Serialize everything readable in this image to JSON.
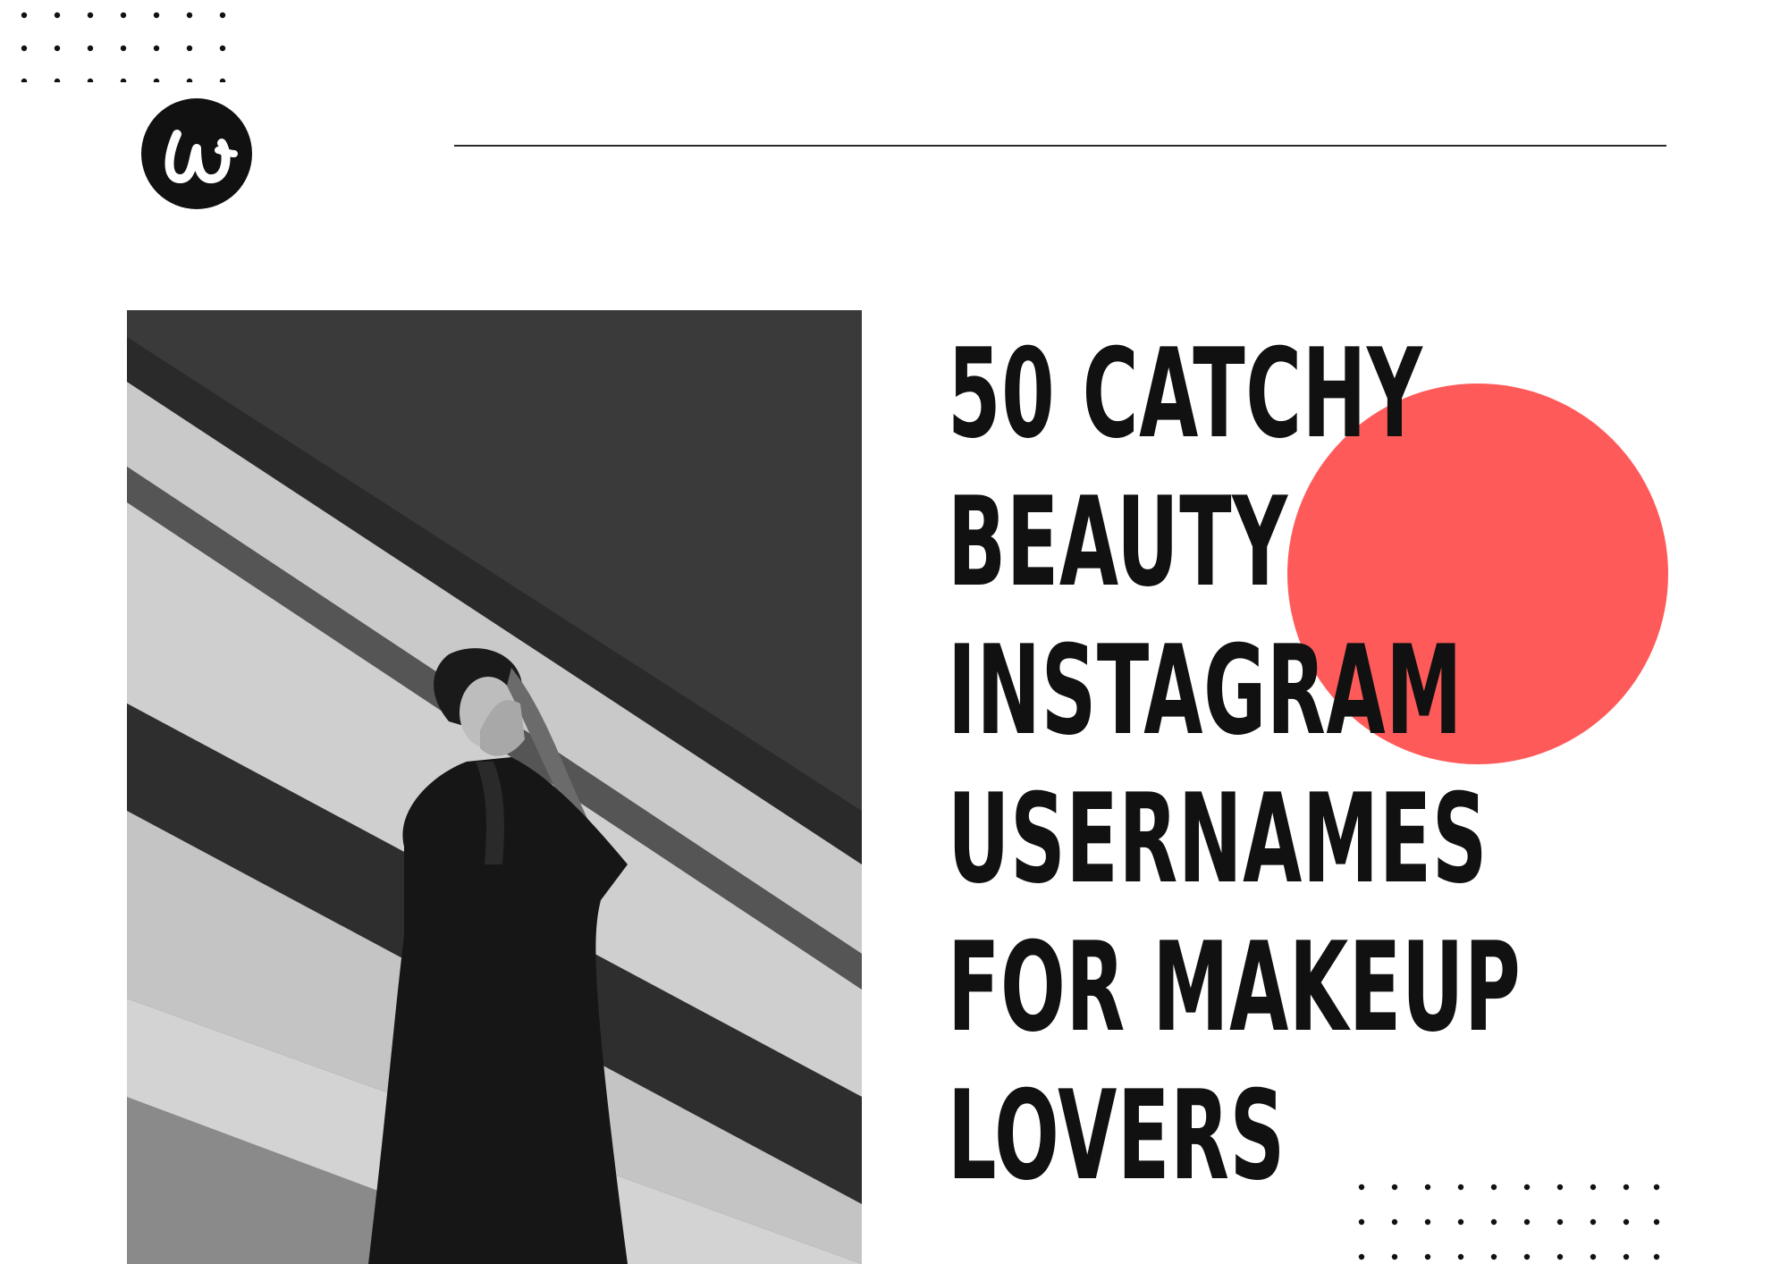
{
  "colors": {
    "background": "#ffffff",
    "accent_circle": "#ff5a5a",
    "text": "#111111",
    "logo": "#111111"
  },
  "logo": {
    "icon": "w-script-logo-icon"
  },
  "headline": {
    "lines": [
      "50 CATCHY",
      "BEAUTY",
      "INSTAGRAM",
      "USERNAMES",
      "FOR MAKEUP",
      "LOVERS"
    ]
  },
  "photo": {
    "icon": "woman-black-and-white-photo"
  }
}
